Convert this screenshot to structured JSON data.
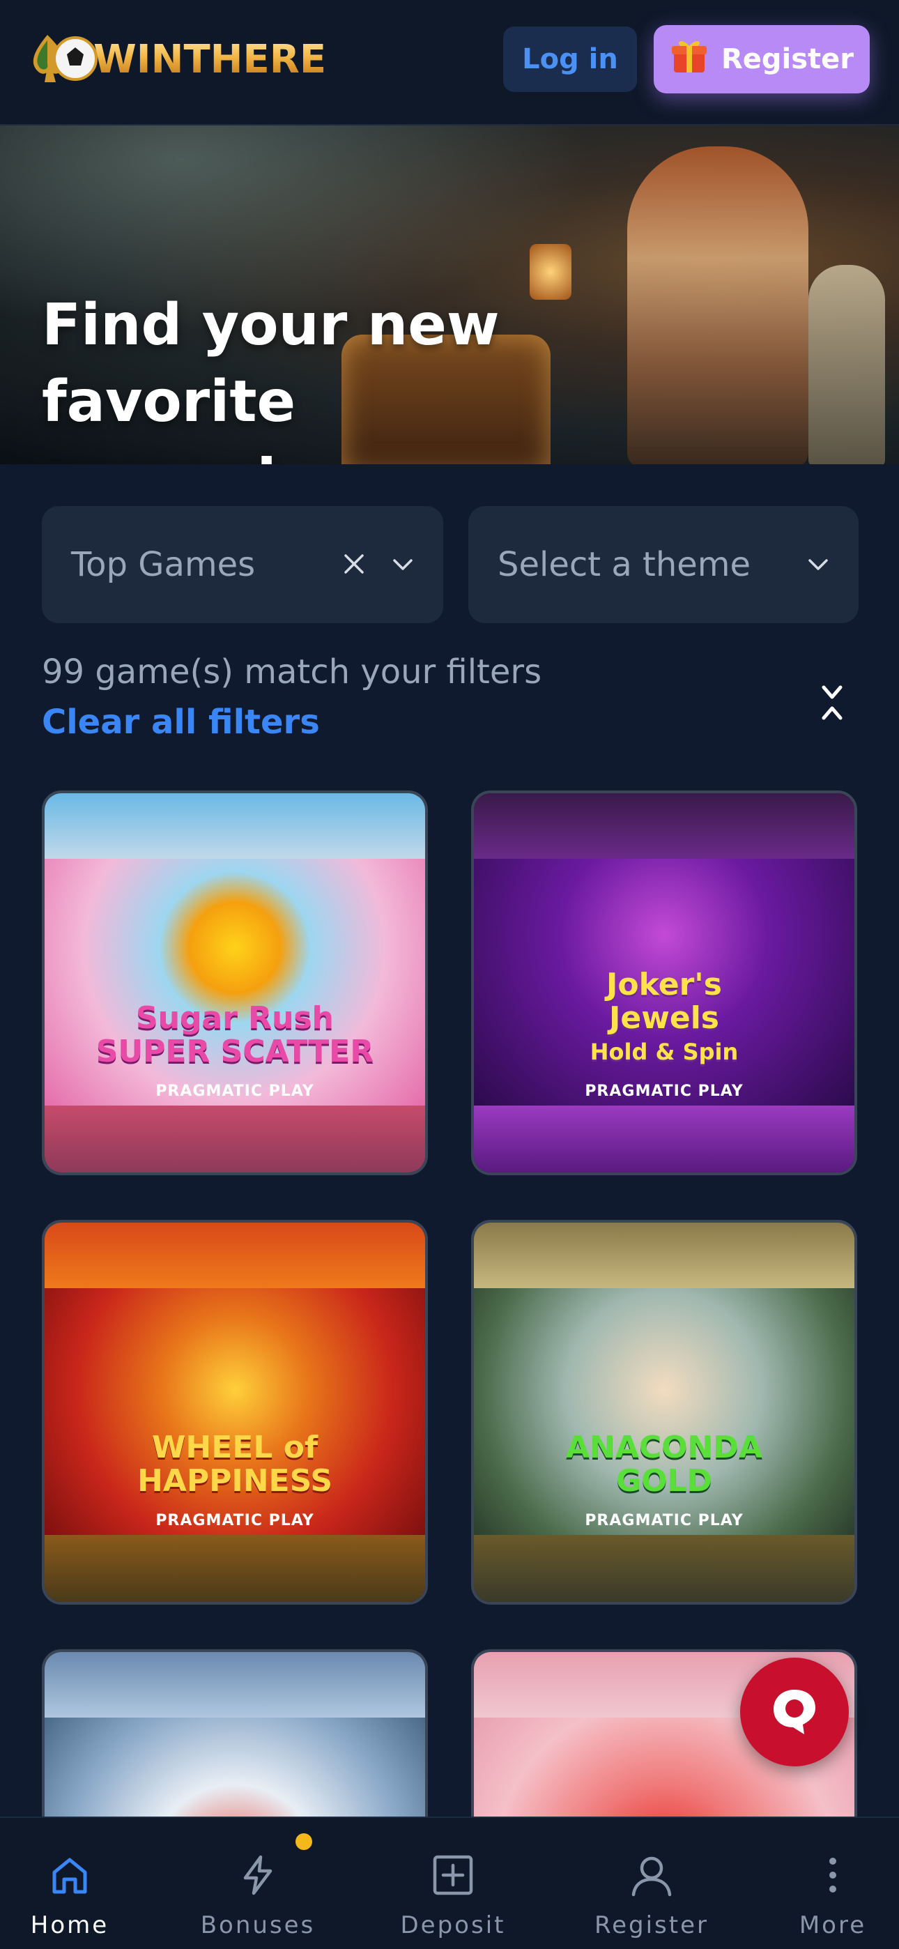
{
  "header": {
    "logo_text": "WINTHERE",
    "login_label": "Log in",
    "register_label": "Register"
  },
  "hero": {
    "title_line1": "Find your new favorite",
    "title_line2": "games!"
  },
  "filters": {
    "category": {
      "value": "Top Games"
    },
    "theme": {
      "placeholder": "Select a theme"
    },
    "match_text": "99 game(s) match your filters",
    "clear_label": "Clear all filters"
  },
  "games": [
    {
      "title": "Sugar Rush Super Scatter",
      "title_lines": [
        "Sugar Rush",
        "SUPER SCATTER"
      ],
      "provider": "PRAGMATIC PLAY"
    },
    {
      "title": "Joker's Jewels Hold & Spin",
      "title_lines": [
        "Joker's",
        "Jewels",
        "Hold & Spin"
      ],
      "provider": "PRAGMATIC PLAY"
    },
    {
      "title": "Wheel of Happiness",
      "title_lines": [
        "WHEEL of",
        "HAPPINESS"
      ],
      "provider": "PRAGMATIC PLAY"
    },
    {
      "title": "Anaconda Gold",
      "title_lines": [
        "ANACONDA",
        "GOLD"
      ],
      "provider": "PRAGMATIC PLAY"
    },
    {
      "title": "",
      "title_lines": [],
      "provider": ""
    },
    {
      "title": "",
      "title_lines": [],
      "provider": ""
    }
  ],
  "nav": {
    "home": "Home",
    "bonuses": "Bonuses",
    "deposit": "Deposit",
    "register": "Register",
    "more": "More"
  },
  "colors": {
    "background": "#0f1a2e",
    "accent_blue": "#3b86f6",
    "register_purple": "#b88af5",
    "chat_red": "#c8102e",
    "badge_yellow": "#f5b81a"
  },
  "icons": {
    "logo": "spade-ball-logo-icon",
    "register_button": "gift-icon",
    "filter_clear": "close-icon",
    "filter_chevron": "chevron-down-icon",
    "collapse": "collapse-icon",
    "chat": "chat-bubble-icon",
    "nav_home": "home-icon",
    "nav_bonuses": "lightning-icon",
    "nav_deposit": "plus-square-icon",
    "nav_register": "user-icon",
    "nav_more": "more-vertical-icon"
  }
}
